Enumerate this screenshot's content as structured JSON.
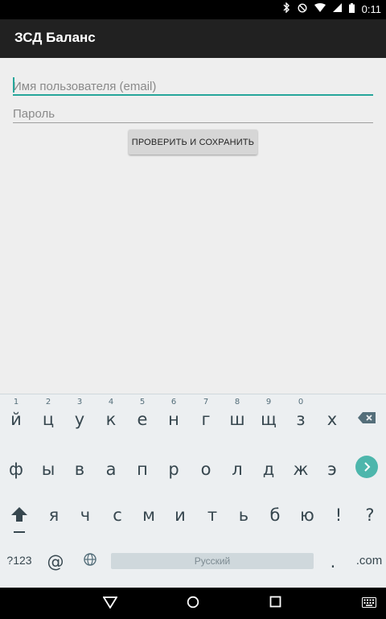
{
  "status_bar": {
    "time": "0:11"
  },
  "app": {
    "title": "ЗСД Баланс"
  },
  "form": {
    "email_placeholder": "Имя пользователя (email)",
    "password_placeholder": "Пароль",
    "save_button": "ПРОВЕРИТЬ И СОХРАНИТЬ"
  },
  "keyboard": {
    "row1": [
      {
        "ch": "й",
        "num": "1"
      },
      {
        "ch": "ц",
        "num": "2"
      },
      {
        "ch": "у",
        "num": "3"
      },
      {
        "ch": "к",
        "num": "4"
      },
      {
        "ch": "е",
        "num": "5"
      },
      {
        "ch": "н",
        "num": "6"
      },
      {
        "ch": "г",
        "num": "7"
      },
      {
        "ch": "ш",
        "num": "8"
      },
      {
        "ch": "щ",
        "num": "9"
      },
      {
        "ch": "з",
        "num": "0"
      },
      {
        "ch": "х",
        "num": ""
      }
    ],
    "row2": [
      "ф",
      "ы",
      "в",
      "а",
      "п",
      "р",
      "о",
      "л",
      "д",
      "ж",
      "э"
    ],
    "row3": [
      "я",
      "ч",
      "с",
      "м",
      "и",
      "т",
      "ь",
      "б",
      "ю",
      "!",
      "?"
    ],
    "symbols_label": "?123",
    "at_label": "@",
    "space_label": "Русский",
    "period_label": ".",
    "dotcom_label": ".com"
  },
  "colors": {
    "accent": "#26a69a",
    "actionbar": "#212121",
    "enter": "#4db6ac"
  }
}
